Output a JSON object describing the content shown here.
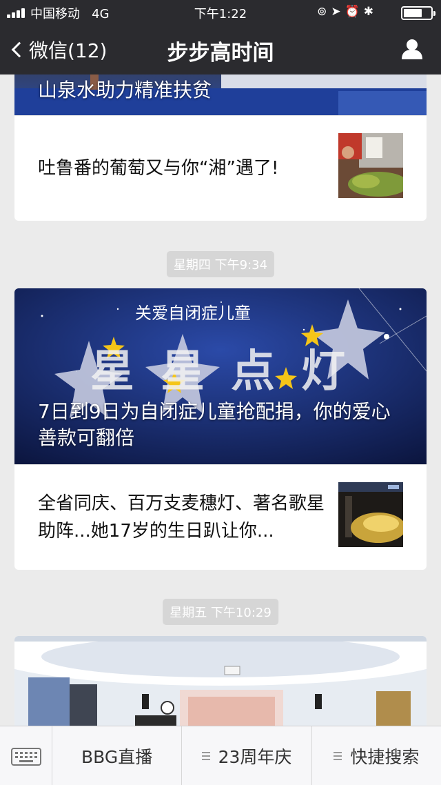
{
  "status_bar": {
    "carrier": "中国移动",
    "network": "4G",
    "time": "下午1:22",
    "icons": [
      "rotation-lock-icon",
      "location-icon",
      "alarm-icon",
      "bluetooth-icon",
      "battery-icon"
    ]
  },
  "nav": {
    "back_label": "微信(12)",
    "title": "步步高时间"
  },
  "feed": {
    "article1": {
      "cover_title": "山泉水助力精准扶贫",
      "items": [
        {
          "title": "吐鲁番的葡萄又与你“湘”遇了!"
        }
      ]
    },
    "time2": "星期四 下午9:34",
    "article2": {
      "cover_title": "7日到9日为自闭症儿童抢配捐，你的爱心善款可翻倍",
      "cover_art": {
        "top_line": "关爱自闭症儿童",
        "big_text": "星星点灯"
      },
      "items": [
        {
          "title": "全省同庆、百万支麦穗灯、著名歌星助阵...她17岁的生日趴让你..."
        }
      ]
    },
    "time3": "星期五 下午10:29"
  },
  "menu": {
    "buttons": [
      {
        "label": "BBG直播"
      },
      {
        "label": "23周年庆"
      },
      {
        "label": "快捷搜索"
      }
    ]
  },
  "colors": {
    "nav_bg": "#2b2b2f",
    "page_bg": "#ebebeb",
    "badge_bg": "#d6d6d6"
  }
}
